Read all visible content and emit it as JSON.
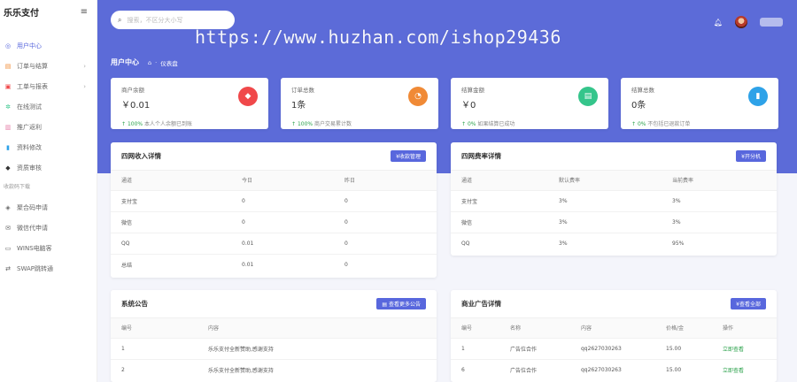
{
  "brand": {
    "name": "乐乐支付",
    "menu_icon": "hamburger-icon"
  },
  "sidebar": {
    "items": [
      {
        "label": "用户中心",
        "icon": "dashboard-icon",
        "active": true
      },
      {
        "label": "订单与结算",
        "icon": "order-icon"
      },
      {
        "label": "工单与报表",
        "icon": "ticket-icon"
      },
      {
        "label": "在线测试",
        "icon": "test-icon"
      },
      {
        "label": "推广返利",
        "icon": "promo-icon"
      },
      {
        "label": "资料修改",
        "icon": "chart-icon"
      },
      {
        "label": "资质审核",
        "icon": "verify-icon"
      }
    ],
    "section_label": "收款码下载",
    "tools": [
      {
        "label": "聚合码申请",
        "icon": "qr-icon"
      },
      {
        "label": "微信代申请",
        "icon": "wechat-icon"
      },
      {
        "label": "WINS电脑客",
        "icon": "pc-icon"
      },
      {
        "label": "SWAP跳转通",
        "icon": "swap-icon"
      }
    ]
  },
  "header": {
    "search_placeholder": "搜索，不区分大小写",
    "watermark": "https://www.huzhan.com/ishop29436"
  },
  "page": {
    "title": "用户中心",
    "breadcrumb": "仪表盘"
  },
  "stats": [
    {
      "label": "商户余额",
      "value": "￥0.01",
      "note_pct": "100%",
      "note_text": "本人个人余额已到账",
      "color": "#f0484a",
      "icon": "diamond-icon"
    },
    {
      "label": "订单总数",
      "value": "1条",
      "note_pct": "100%",
      "note_text": "商户交易累计数",
      "color": "#f08a36",
      "icon": "pie-icon"
    },
    {
      "label": "结算金额",
      "value": "￥0",
      "note_pct": "0%",
      "note_text": "如果结算已成功",
      "color": "#35c58b",
      "icon": "receipt-icon"
    },
    {
      "label": "结算总数",
      "value": "0条",
      "note_pct": "0%",
      "note_text": "不包括已退款订单",
      "color": "#2ea2e8",
      "icon": "bar-chart-icon"
    }
  ],
  "income": {
    "title": "四网收入详情",
    "button": "¥收款管理",
    "columns": [
      "通道",
      "今日",
      "昨日"
    ],
    "rows": [
      [
        "支付宝",
        "0",
        "0"
      ],
      [
        "微信",
        "0",
        "0"
      ],
      [
        "QQ",
        "0.01",
        "0"
      ],
      [
        "总结",
        "0.01",
        "0"
      ]
    ]
  },
  "rates": {
    "title": "四网费率详情",
    "button": "¥开分机",
    "columns": [
      "通道",
      "默认费率",
      "当前费率"
    ],
    "rows": [
      [
        "支付宝",
        "3%",
        "3%"
      ],
      [
        "微信",
        "3%",
        "3%"
      ],
      [
        "QQ",
        "3%",
        "95%"
      ]
    ]
  },
  "notice": {
    "title": "系统公告",
    "button": "查看更多公告",
    "columns": [
      "编号",
      "内容"
    ],
    "rows": [
      [
        "1",
        "乐乐支付全新赞助,感谢支持"
      ],
      [
        "2",
        "乐乐支付全新赞助,感谢支持"
      ]
    ]
  },
  "ads": {
    "title": "商业广告详情",
    "button": "¥查看全部",
    "columns": [
      "编号",
      "名称",
      "内容",
      "价格/金",
      "操作"
    ],
    "rows": [
      [
        "1",
        "广告位合作",
        "qq2627030263",
        "15.00",
        "立即查看"
      ],
      [
        "6",
        "广告位合作",
        "qq2627030263",
        "15.00",
        "立即查看"
      ]
    ]
  }
}
